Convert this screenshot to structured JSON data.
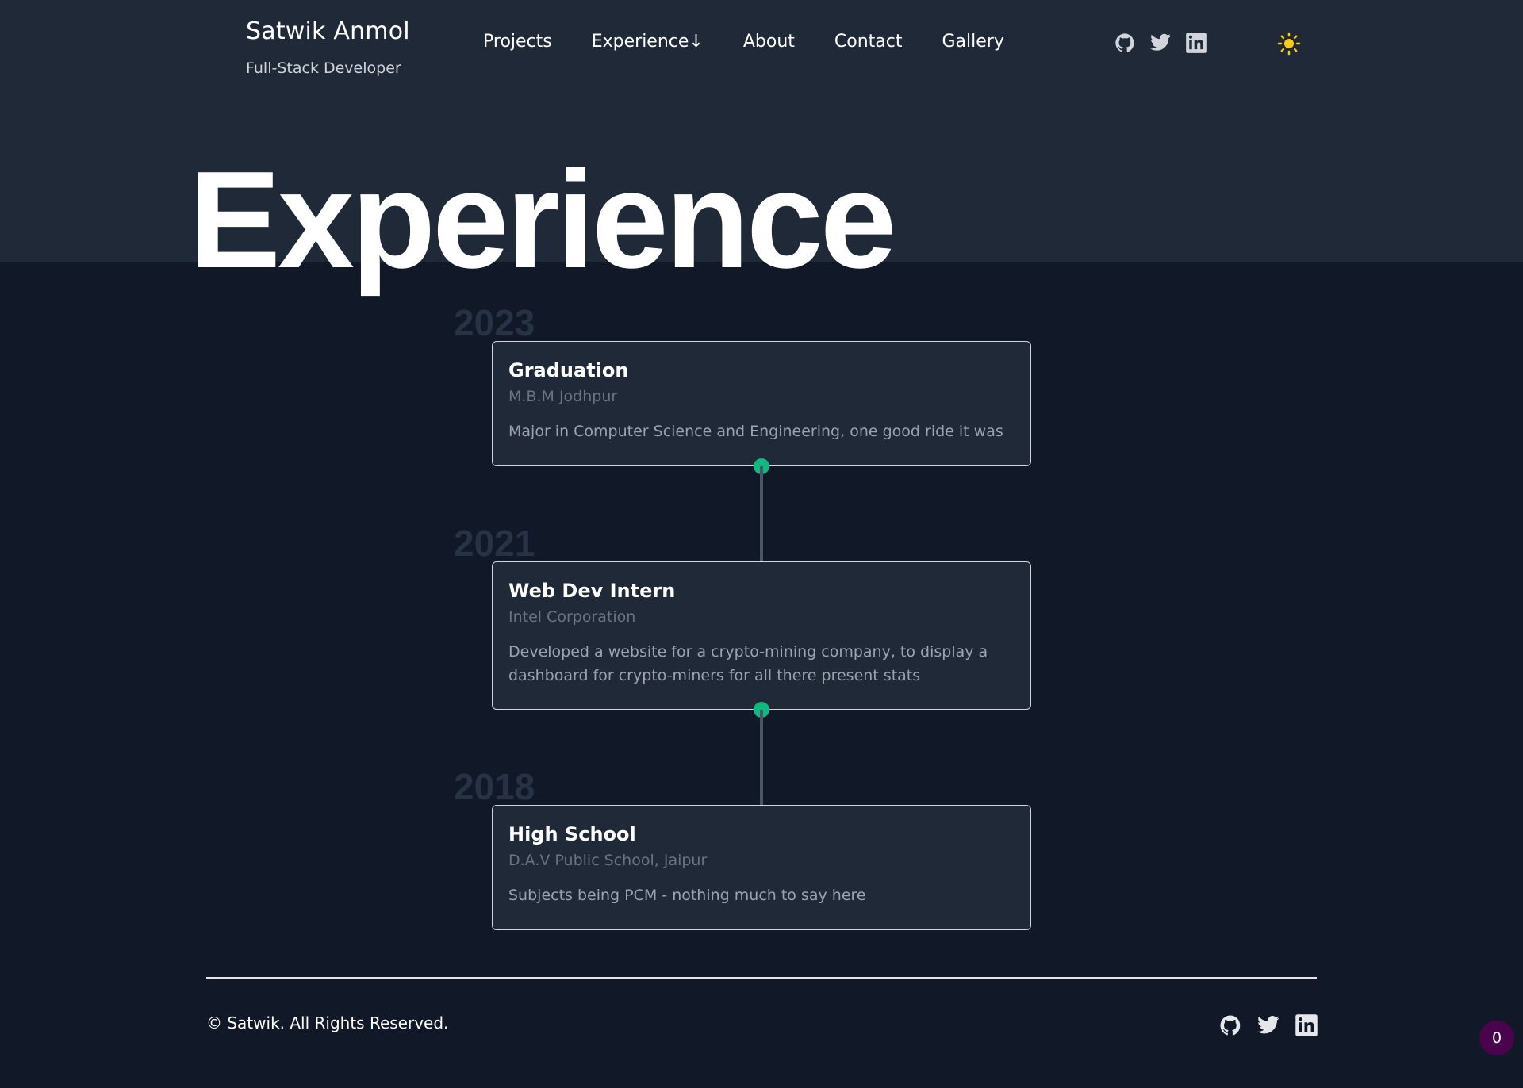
{
  "brand": {
    "name": "Satwik Anmol",
    "role": "Full-Stack Developer"
  },
  "nav": {
    "items": [
      "Projects",
      "Experience↓",
      "About",
      "Contact",
      "Gallery"
    ]
  },
  "header_social": [
    "github-icon",
    "twitter-icon",
    "linkedin-icon"
  ],
  "theme_toggle": {
    "icon": "sun-icon",
    "color": "#facc15"
  },
  "page_title": "Experience",
  "timeline": [
    {
      "year": "2023",
      "title": "Graduation",
      "org": "M.B.M Jodhpur",
      "desc": "Major in Computer Science and Engineering, one good ride it was"
    },
    {
      "year": "2021",
      "title": "Web Dev Intern",
      "org": "Intel Corporation",
      "desc": "Developed a website for a crypto-mining company, to display a dashboard for crypto-miners for all there present stats"
    },
    {
      "year": "2018",
      "title": "High School",
      "org": "D.A.V Public School, Jaipur",
      "desc": "Subjects being PCM - nothing much to say here"
    }
  ],
  "footer": {
    "copyright": "© Satwik. All Rights Reserved.",
    "social": [
      "github-icon",
      "twitter-icon",
      "linkedin-icon"
    ]
  },
  "counter": "0",
  "colors": {
    "accent_dot": "#10b981",
    "background": "#111827",
    "header_band": "#1f2937"
  }
}
